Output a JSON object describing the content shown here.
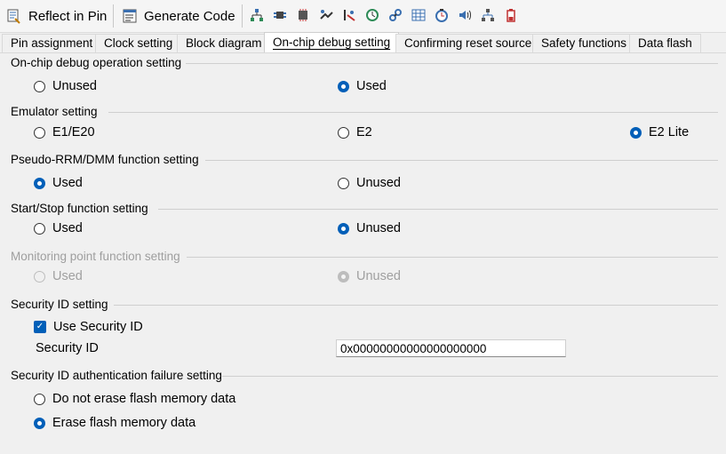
{
  "toolbar": {
    "reflect_label": "Reflect in Pin",
    "generate_label": "Generate Code",
    "icons": [
      "components-tree-icon",
      "pins-icon",
      "chip-icon",
      "dma-icon",
      "interrupt-icon",
      "clock-icon",
      "link-icon",
      "grid-icon",
      "timer-icon",
      "sound-icon",
      "network-icon",
      "battery-icon"
    ]
  },
  "tabs": [
    {
      "label": "Pin assignment"
    },
    {
      "label": "Clock setting"
    },
    {
      "label": "Block diagram"
    },
    {
      "label": "On-chip debug setting"
    },
    {
      "label": "Confirming reset source"
    },
    {
      "label": "Safety functions"
    },
    {
      "label": "Data flash"
    }
  ],
  "active_tab": "On-chip debug setting",
  "groups": {
    "debug_op": {
      "title": "On-chip debug operation setting",
      "options": [
        "Unused",
        "Used"
      ],
      "selected": "Used"
    },
    "emulator": {
      "title": "Emulator setting",
      "options": [
        "E1/E20",
        "E2",
        "E2 Lite"
      ],
      "selected": "E2 Lite"
    },
    "pseudo_rrm": {
      "title": "Pseudo-RRM/DMM function setting",
      "options": [
        "Used",
        "Unused"
      ],
      "selected": "Used"
    },
    "start_stop": {
      "title": "Start/Stop function setting",
      "options": [
        "Used",
        "Unused"
      ],
      "selected": "Unused"
    },
    "monitoring": {
      "title": "Monitoring point function setting",
      "options": [
        "Used",
        "Unused"
      ],
      "selected": "Unused",
      "disabled": true
    },
    "security_id": {
      "title": "Security ID setting",
      "checkbox_label": "Use Security ID",
      "checked": true,
      "field_label": "Security ID",
      "field_value": "0x00000000000000000000"
    },
    "auth_fail": {
      "title": "Security ID authentication failure setting",
      "options": [
        "Do not erase flash memory data",
        "Erase flash memory data"
      ],
      "selected": "Erase flash memory data"
    }
  },
  "colors": {
    "accent": "#005fb8",
    "disabled": "#a0a0a0"
  }
}
